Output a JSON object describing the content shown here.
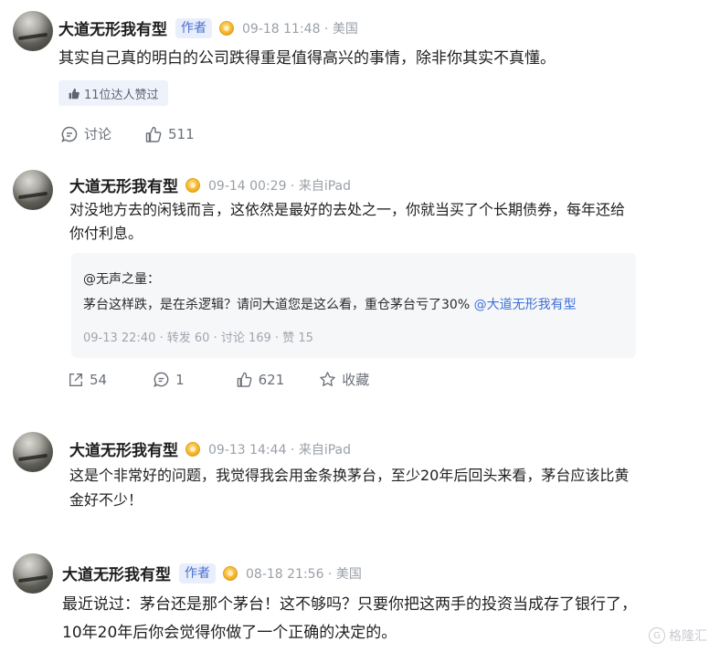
{
  "posts": [
    {
      "author": "大道无形我有型",
      "badge": "作者",
      "time": "09-18 11:48 · 美国",
      "text": "其实自己真的明白的公司跌得重是值得高兴的事情，除非你其实不真懂。",
      "likes_chip": "11位达人赞过",
      "discuss_label": "讨论",
      "like_count": "511"
    },
    {
      "author": "大道无形我有型",
      "time": "09-14 00:29 · 来自iPad",
      "text_line1": "对没地方去的闲钱而言，这依然是最好的去处之一，你就当买了个长期债券，每年还给",
      "text_line2": "你付利息。",
      "quote": {
        "user": "@无声之量：",
        "text": "茅台这样跌，是在杀逻辑？请问大道您是这么看，重仓茅台亏了30%",
        "mention": "@大道无形我有型",
        "meta": "09-13 22:40 · 转发 60 · 讨论 169 · 赞 15"
      },
      "share_count": "54",
      "comment_count": "1",
      "like_count": "621",
      "favorite_label": "收藏"
    },
    {
      "author": "大道无形我有型",
      "time": "09-13 14:44 · 来自iPad",
      "text_line1": "这是个非常好的问题，我觉得我会用金条换茅台，至少20年后回头来看，茅台应该比黄",
      "text_line2": "金好不少！"
    },
    {
      "author": "大道无形我有型",
      "badge": "作者",
      "time": "08-18 21:56 · 美国",
      "text_line1": "最近说过：茅台还是那个茅台！这不够吗？只要你把这两手的投资当成存了银行了，",
      "text_line2": "10年20年后你会觉得你做了一个正确的决定的。"
    }
  ],
  "watermark": "格隆汇",
  "colors": {
    "accent": "#4a6fd1",
    "link": "#3f6fd8",
    "quote_bg": "#f6f7f9"
  }
}
